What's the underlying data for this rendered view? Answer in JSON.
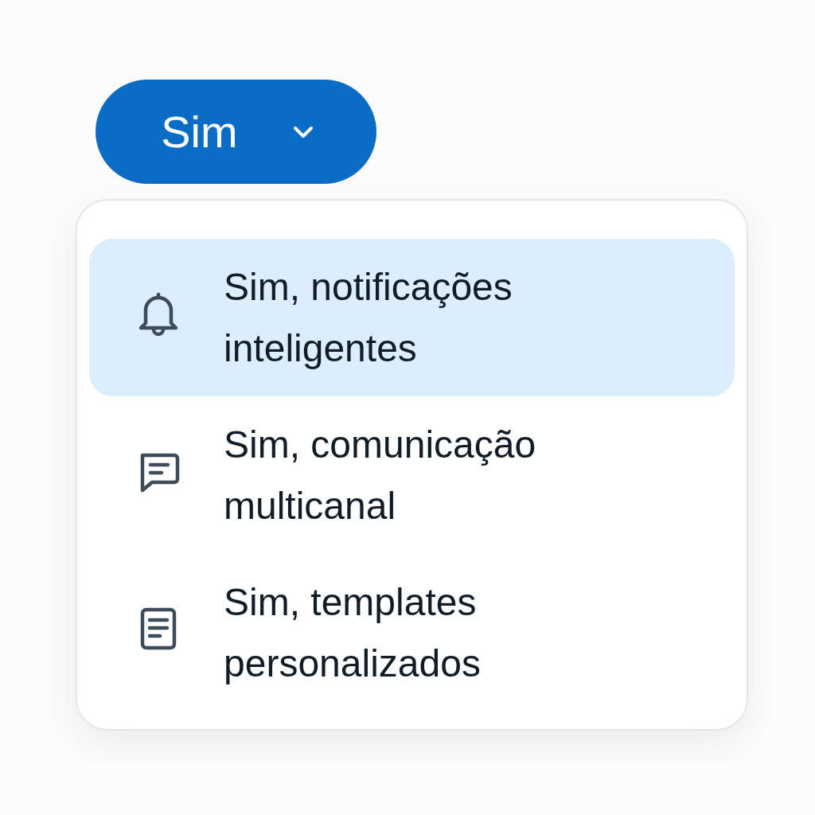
{
  "button": {
    "label": "Sim",
    "expanded": true
  },
  "menu": {
    "items": [
      {
        "label": "Sim, notificações inteligentes",
        "kind": "bell",
        "selected": true
      },
      {
        "label": "Sim, comunicação multicanal",
        "kind": "chat",
        "selected": false
      },
      {
        "label": "Sim, templates personalizados",
        "kind": "document",
        "selected": false
      }
    ]
  }
}
